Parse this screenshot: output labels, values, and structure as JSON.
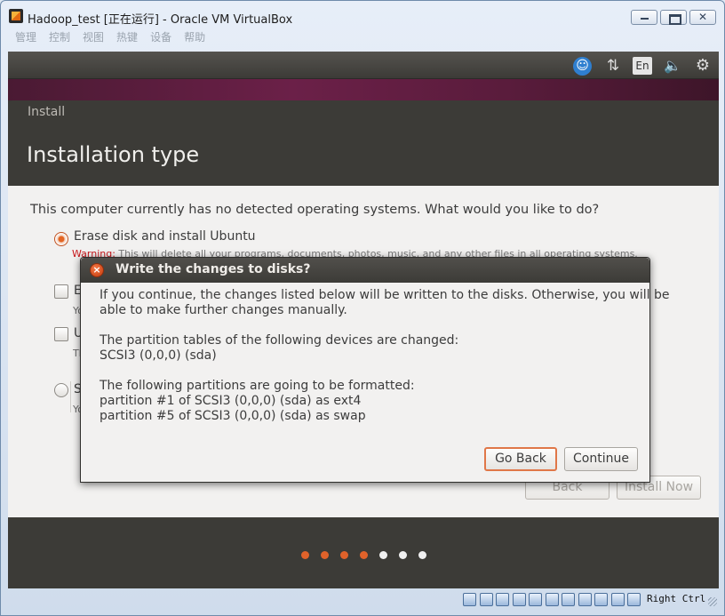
{
  "window": {
    "title": "Hadoop_test [正在运行] - Oracle VM VirtualBox",
    "close_glyph": "✕"
  },
  "menu": [
    "管理",
    "控制",
    "视图",
    "热键",
    "设备",
    "帮助"
  ],
  "topbar": {
    "language": "En",
    "icons": [
      "accessibility-icon",
      "network-icon",
      "keyboard-layout-icon",
      "volume-icon",
      "settings-icon"
    ]
  },
  "installer": {
    "window_title": "Install",
    "page_title": "Installation type",
    "question": "This computer currently has no detected operating systems. What would you like to do?",
    "options": {
      "erase": {
        "label": "Erase disk and install Ubuntu",
        "warning_prefix": "Warning:",
        "warning_text": " This will delete all your programs, documents, photos, music, and any other files in all operating systems.",
        "selected": true
      },
      "encrypt": {
        "label": "E",
        "sub": "Yo"
      },
      "lvm": {
        "label": "U",
        "sub": "Th"
      },
      "something_else": {
        "label": "S",
        "sub": "Yo"
      }
    },
    "buttons": {
      "back": "Back",
      "install_now": "Install Now"
    },
    "progress": {
      "steps_total": 7,
      "steps_done": 4
    }
  },
  "dialog": {
    "title": "Write the changes to disks?",
    "close_glyph": "×",
    "intro_line1": "If you continue, the changes listed below will be written to the disks. Otherwise, you will be",
    "intro_line2": "able to make further changes manually.",
    "partition_tables_heading": "The partition tables of the following devices are changed:",
    "partition_tables": [
      " SCSI3 (0,0,0) (sda)"
    ],
    "format_heading": "The following partitions are going to be formatted:",
    "formatted_partitions": [
      " partition #1 of SCSI3 (0,0,0) (sda) as ext4",
      " partition #5 of SCSI3 (0,0,0) (sda) as swap"
    ],
    "buttons": {
      "go_back": "Go Back",
      "continue": "Continue"
    }
  },
  "statusbar": {
    "host_key": "Right Ctrl",
    "icons": [
      "hard-disk-icon",
      "optical-drive-icon",
      "audio-icon",
      "network-adapter-icon",
      "usb-icon",
      "shared-folders-icon",
      "display-icon",
      "video-capture-icon",
      "cpu-virtualization-icon",
      "mouse-integration-icon",
      "keyboard-capture-icon"
    ]
  },
  "colors": {
    "ubuntu_orange": "#e0622a",
    "ubuntu_dark": "#3c3b37",
    "aubergine": "#6b2048",
    "warning_red": "#c7161a"
  }
}
